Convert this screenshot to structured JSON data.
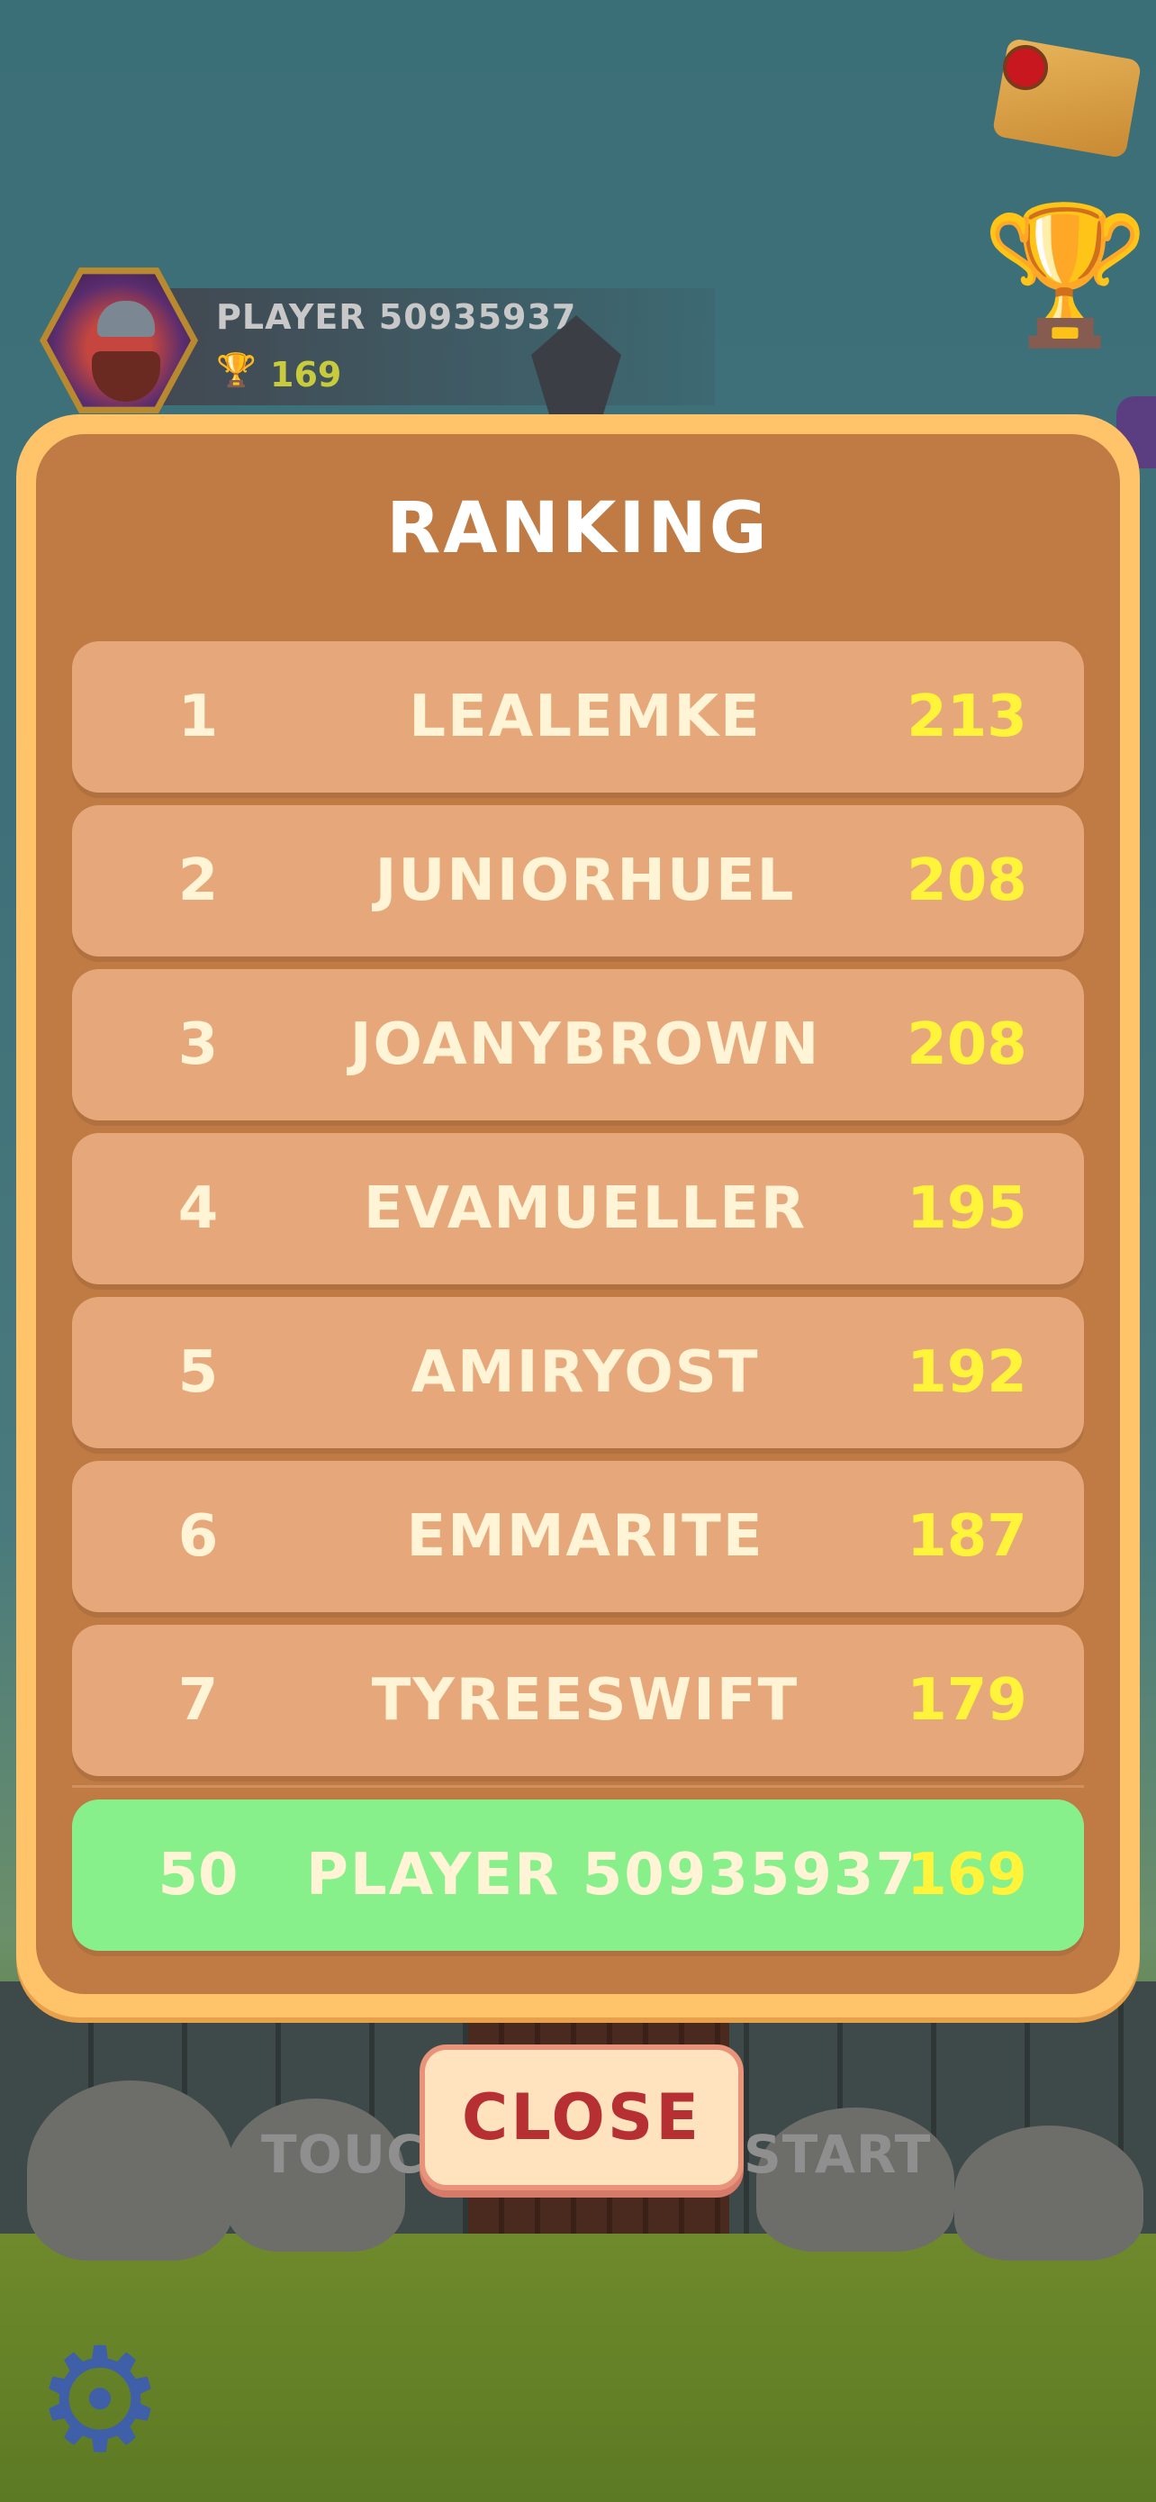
{
  "header": {
    "player_name": "PLAYER 50935937",
    "player_trophies": "169",
    "trophy_icon": "🏆"
  },
  "ranking": {
    "title": "RANKING",
    "rows": [
      {
        "rank": "1",
        "name": "LEALEMKE",
        "score": "213"
      },
      {
        "rank": "2",
        "name": "JUNIORHUEL",
        "score": "208"
      },
      {
        "rank": "3",
        "name": "JOANYBROWN",
        "score": "208"
      },
      {
        "rank": "4",
        "name": "EVAMUELLER",
        "score": "195"
      },
      {
        "rank": "5",
        "name": "AMIRYOST",
        "score": "192"
      },
      {
        "rank": "6",
        "name": "EMMARITE",
        "score": "187"
      },
      {
        "rank": "7",
        "name": "TYREESWIFT",
        "score": "179"
      }
    ],
    "current_player": {
      "rank": "50",
      "name": "PLAYER 50935937",
      "score": "169"
    }
  },
  "close_label": "CLOSE",
  "background": {
    "touch_left": "TOUCH",
    "touch_right": "START"
  },
  "colors": {
    "modal_frame": "#ffc36a",
    "modal_body": "#c07a44",
    "row": "#e6a87a",
    "highlight_row": "#88f08a",
    "score": "#fff43a",
    "close_text": "#b62f32"
  }
}
